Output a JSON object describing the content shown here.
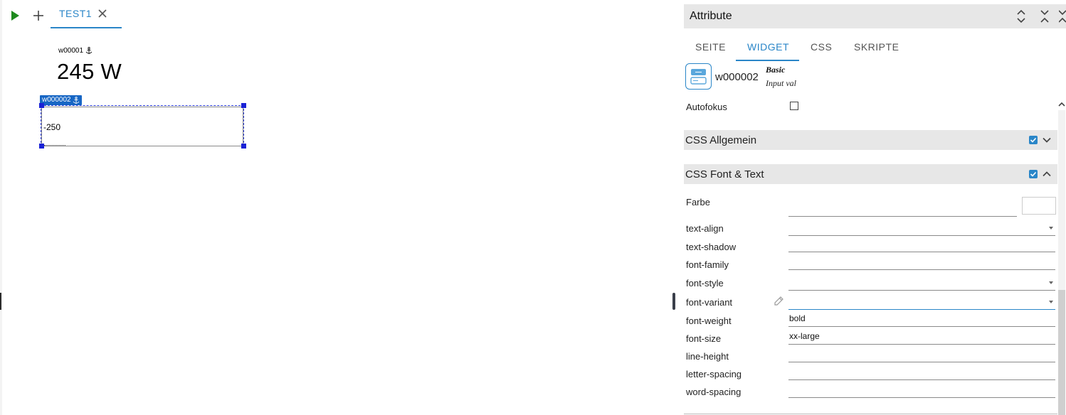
{
  "toolbar": {
    "play_icon": "play-icon",
    "add_icon": "plus-icon"
  },
  "view_tab": {
    "label": "TEST1",
    "close_icon": "close-icon"
  },
  "canvas": {
    "widget1": {
      "label": "w00001",
      "value": "245 W",
      "anchor_icon": "anchor-icon"
    },
    "widget2": {
      "tag": "w000002",
      "input_value": "-250",
      "anchor_icon": "anchor-icon"
    }
  },
  "panel": {
    "title": "Attribute",
    "header_icons": [
      "expand-vertical-icon",
      "collapse-vertical-icon",
      "collapse-close-icon"
    ],
    "tabs": [
      {
        "label": "SEITE",
        "active": false
      },
      {
        "label": "WIDGET",
        "active": true
      },
      {
        "label": "CSS",
        "active": false
      },
      {
        "label": "SKRIPTE",
        "active": false
      }
    ],
    "widget_info": {
      "id": "w000002",
      "set": "Basic",
      "type": "Input val",
      "icon": "input-widget-icon"
    },
    "autofokus": {
      "label": "Autofokus",
      "checked": false
    },
    "sections": [
      {
        "title": "CSS Allgemein",
        "enabled": true,
        "expanded": false
      },
      {
        "title": "CSS Font & Text",
        "enabled": true,
        "expanded": true
      }
    ],
    "props": {
      "farbe": {
        "label": "Farbe",
        "value": ""
      },
      "text_align": {
        "label": "text-align",
        "value": ""
      },
      "text_shadow": {
        "label": "text-shadow",
        "value": ""
      },
      "font_family": {
        "label": "font-family",
        "value": ""
      },
      "font_style": {
        "label": "font-style",
        "value": ""
      },
      "font_variant": {
        "label": "font-variant",
        "value": ""
      },
      "font_weight": {
        "label": "font-weight",
        "value": "bold"
      },
      "font_size": {
        "label": "font-size",
        "value": "xx-large"
      },
      "line_height": {
        "label": "line-height",
        "value": ""
      },
      "letter_spacing": {
        "label": "letter-spacing",
        "value": ""
      },
      "word_spacing": {
        "label": "word-spacing",
        "value": ""
      }
    },
    "colors": {
      "accent": "#2a86c8",
      "header_bg": "#e7e7e7",
      "selection": "#1a22d6",
      "play": "#1f8a1f"
    }
  }
}
